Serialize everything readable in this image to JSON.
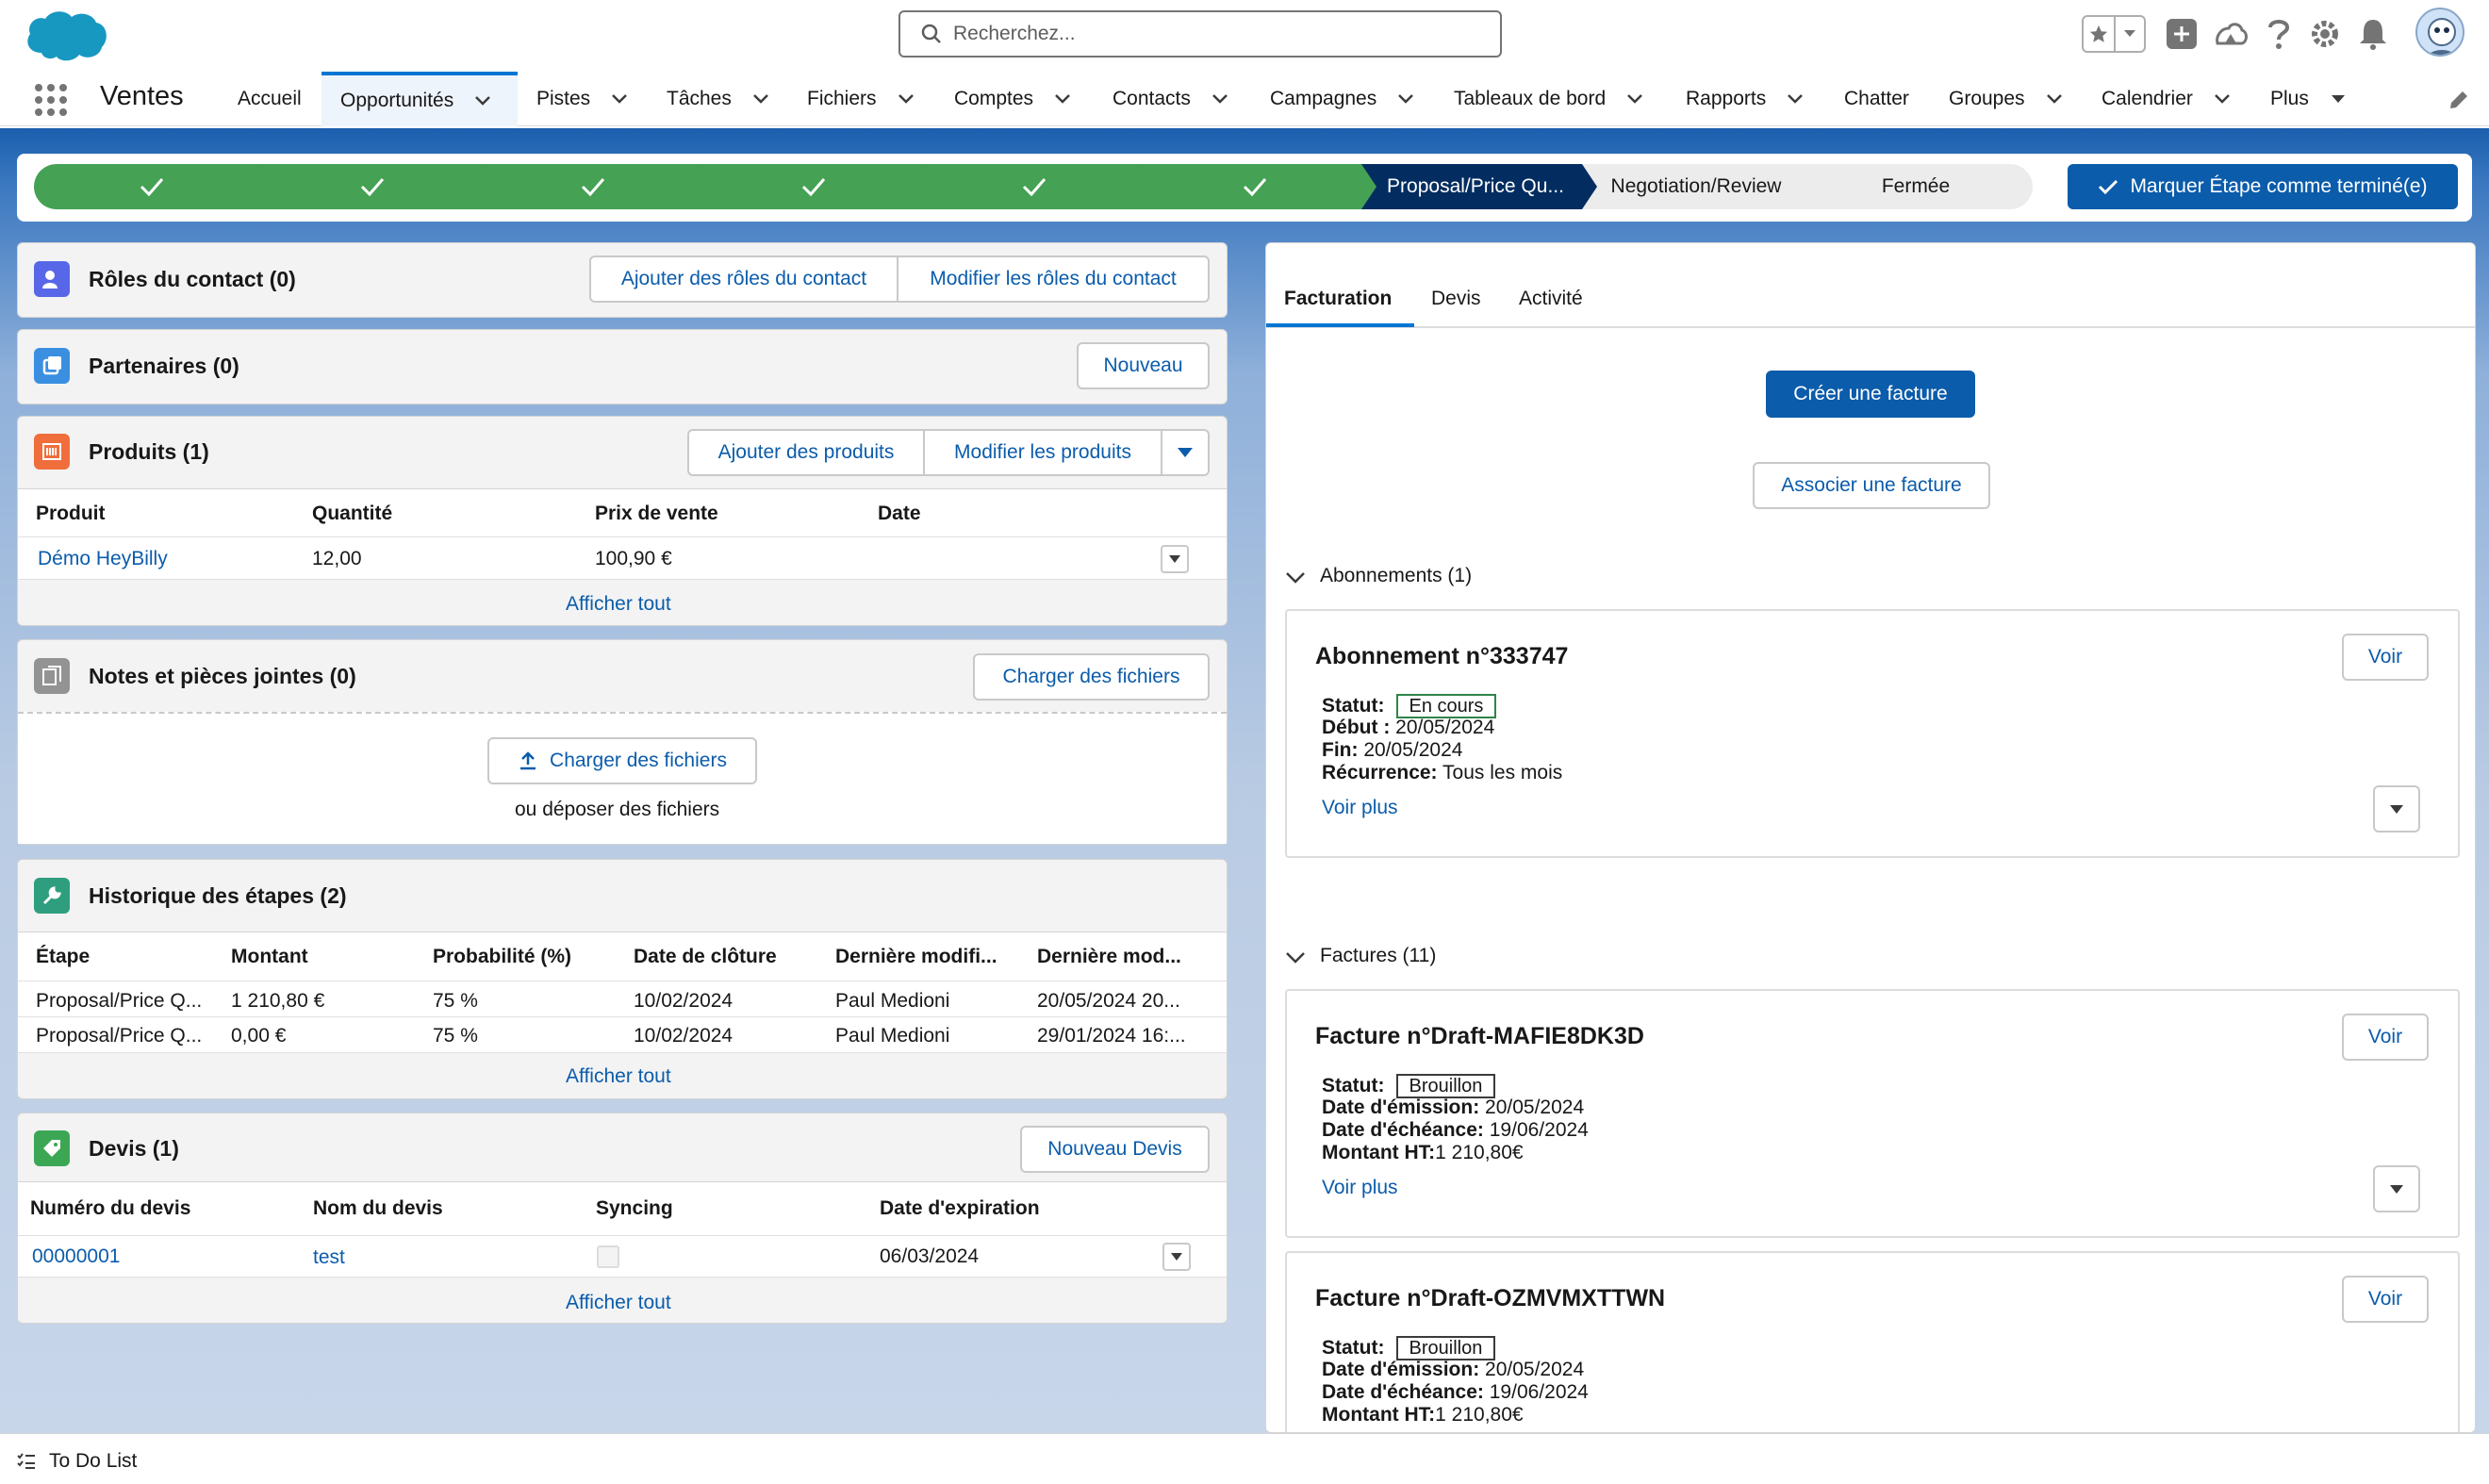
{
  "header": {
    "search_placeholder": "Recherchez...",
    "icons": [
      "favorites-star-icon",
      "favorites-dropdown-icon",
      "global-actions-add-icon",
      "trailhead-icon",
      "help-icon",
      "setup-gear-icon",
      "notifications-bell-icon",
      "user-avatar"
    ]
  },
  "nav": {
    "app_name": "Ventes",
    "items": [
      {
        "label": "Accueil"
      },
      {
        "label": "Opportunités"
      },
      {
        "label": "Pistes"
      },
      {
        "label": "Tâches"
      },
      {
        "label": "Fichiers"
      },
      {
        "label": "Comptes"
      },
      {
        "label": "Contacts"
      },
      {
        "label": "Campagnes"
      },
      {
        "label": "Tableaux de bord"
      },
      {
        "label": "Rapports"
      },
      {
        "label": "Chatter"
      },
      {
        "label": "Groupes"
      },
      {
        "label": "Calendrier"
      },
      {
        "label": "Plus"
      }
    ]
  },
  "path": {
    "current_stage": "Proposal/Price Qu...",
    "next_stages": [
      "Negotiation/Review",
      "Fermée"
    ],
    "mark_button": "Marquer Étape comme terminé(e)"
  },
  "contact_roles": {
    "title": "Rôles du contact (0)",
    "add_button": "Ajouter des rôles du contact",
    "edit_button": "Modifier les rôles du contact"
  },
  "partners": {
    "title": "Partenaires (0)",
    "new_button": "Nouveau"
  },
  "products": {
    "title": "Produits (1)",
    "add_button": "Ajouter des produits",
    "edit_button": "Modifier les produits",
    "columns": [
      "Produit",
      "Quantité",
      "Prix de vente",
      "Date"
    ],
    "rows": [
      {
        "product": "Démo HeyBilly",
        "qty": "12,00",
        "price": "100,90 €",
        "date": ""
      }
    ],
    "view_all": "Afficher tout"
  },
  "notes": {
    "title": "Notes et pièces jointes (0)",
    "upload_button": "Charger des fichiers",
    "drop_button": "Charger des fichiers",
    "drop_text": "ou déposer des fichiers"
  },
  "history": {
    "title": "Historique des étapes (2)",
    "columns": [
      "Étape",
      "Montant",
      "Probabilité (%)",
      "Date de clôture",
      "Dernière modifi...",
      "Dernière mod..."
    ],
    "rows": [
      [
        "Proposal/Price Q...",
        "1 210,80 €",
        "75 %",
        "10/02/2024",
        "Paul Medioni",
        "20/05/2024 20..."
      ],
      [
        "Proposal/Price Q...",
        "0,00 €",
        "75 %",
        "10/02/2024",
        "Paul Medioni",
        "29/01/2024 16:..."
      ]
    ],
    "view_all": "Afficher tout"
  },
  "quotes": {
    "title": "Devis (1)",
    "new_button": "Nouveau Devis",
    "columns": [
      "Numéro du devis",
      "Nom du devis",
      "Syncing",
      "Date d'expiration"
    ],
    "rows": [
      {
        "number": "00000001",
        "name": "test",
        "syncing": false,
        "expiry": "06/03/2024"
      }
    ],
    "view_all": "Afficher tout"
  },
  "right": {
    "tabs": [
      "Facturation",
      "Devis",
      "Activité"
    ],
    "create_invoice": "Créer une facture",
    "associate_invoice": "Associer une facture",
    "subscriptions_header": "Abonnements (1)",
    "subscription": {
      "title": "Abonnement n°333747",
      "view": "Voir",
      "status_label": "Statut:",
      "status": "En cours",
      "start_label": "Début :",
      "start": "20/05/2024",
      "end_label": "Fin:",
      "end": "20/05/2024",
      "recurrence_label": "Récurrence:",
      "recurrence": "Tous les mois",
      "more": "Voir plus"
    },
    "invoices_header": "Factures (11)",
    "invoices": [
      {
        "title": "Facture n°Draft-MAFIE8DK3D",
        "view": "Voir",
        "status_label": "Statut:",
        "status": "Brouillon",
        "issue_label": "Date d'émission:",
        "issue": "20/05/2024",
        "due_label": "Date d'échéance:",
        "due": "19/06/2024",
        "amount_label": "Montant HT:",
        "amount": "1 210,80€",
        "more": "Voir plus"
      },
      {
        "title": "Facture n°Draft-OZMVMXTTWN",
        "view": "Voir",
        "status_label": "Statut:",
        "status": "Brouillon",
        "issue_label": "Date d'émission:",
        "issue": "20/05/2024",
        "due_label": "Date d'échéance:",
        "due": "19/06/2024",
        "amount_label": "Montant HT:",
        "amount": "1 210,80€"
      }
    ]
  },
  "footer": {
    "todo": "To Do List"
  },
  "colors": {
    "brand": "#0176d3",
    "button": "#0b5cab",
    "path_complete": "#45a154",
    "path_current": "#032d60"
  }
}
